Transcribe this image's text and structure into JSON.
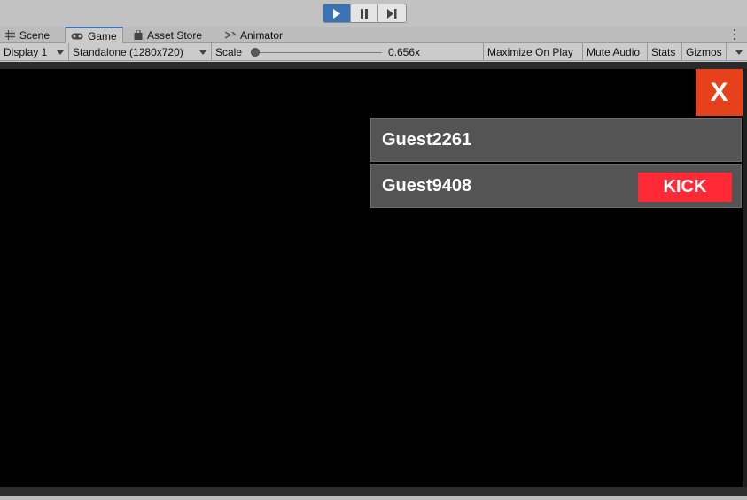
{
  "play_controls": {
    "play_icon": "play-icon",
    "pause_icon": "pause-icon",
    "step_icon": "step-icon",
    "active_color": "#3a72b6"
  },
  "tabs": [
    {
      "label": "Scene",
      "icon": "grid-icon"
    },
    {
      "label": "Game",
      "icon": "gamepad-icon"
    },
    {
      "label": "Asset Store",
      "icon": "bag-icon"
    },
    {
      "label": "Animator",
      "icon": "animator-icon"
    }
  ],
  "game_toolbar": {
    "display": "Display 1",
    "resolution": "Standalone (1280x720)",
    "scale_label": "Scale",
    "scale_value": "0.656x",
    "scale_fraction": 0.0,
    "maximize": "Maximize On Play",
    "mute": "Mute Audio",
    "stats": "Stats",
    "gizmos": "Gizmos"
  },
  "game": {
    "close_label": "X",
    "close_color": "#e6411b",
    "players": [
      {
        "name": "Guest2261",
        "kick": null
      },
      {
        "name": "Guest9408",
        "kick": "KICK"
      }
    ],
    "kick_color": "#ff2a36"
  }
}
